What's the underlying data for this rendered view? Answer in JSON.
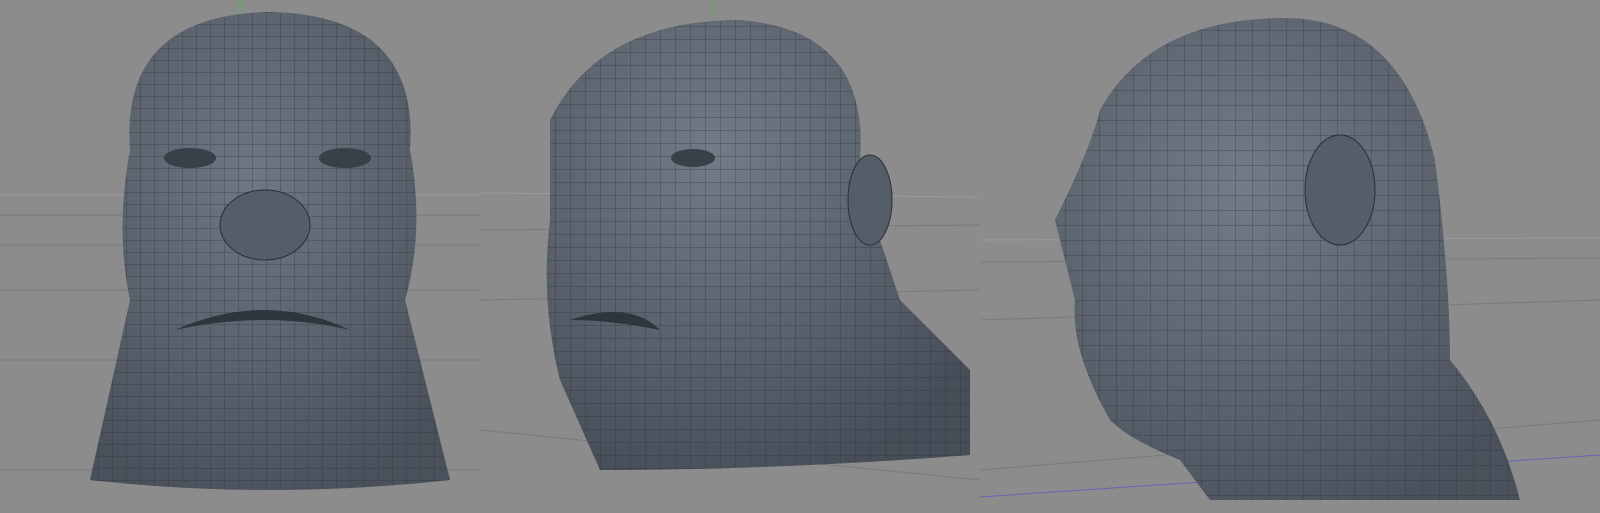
{
  "viewports": [
    {
      "view": "front"
    },
    {
      "view": "three-quarter"
    },
    {
      "view": "side"
    }
  ],
  "colors": {
    "background": "#8c8c8c",
    "mesh": "#5d6570",
    "wire": "#2a2f36",
    "grid": "#7a7a7a",
    "axis_green": "#3fbf3f",
    "axis_blue": "#4a4ad0",
    "axis_red": "#c04040"
  }
}
